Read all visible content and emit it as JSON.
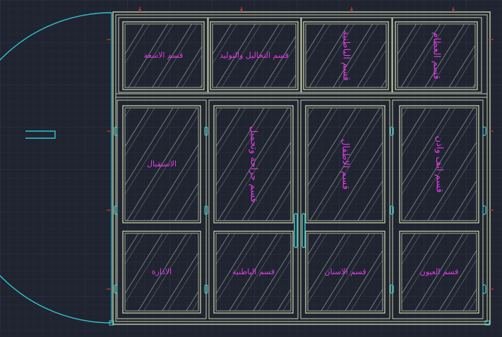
{
  "canvas": {
    "background": "#1f2430",
    "grid_minor": "#262c39",
    "grid_major": "#2e3544",
    "frame_color": "#c9cfa8",
    "glass_hatch_color": "#9aa39a",
    "label_color": "#e13ce6",
    "hinge_color": "#3fc6c6",
    "door_swing_color": "#33c4d4",
    "dimension_tick_color": "#c83a3a"
  },
  "top_row_labels": [
    "قسم الاشعة",
    "قسم التحاليل والتوليد",
    "قسم الباطنية",
    "قسم العظام"
  ],
  "middle_row_labels": [
    "الاستقبال",
    "قسم جراحة وتجميل",
    "قسم الاطفال",
    "قسم انف واذن"
  ],
  "bottom_row_labels": [
    "الادارة",
    "قسم الباطنية",
    "قسم الاسنان",
    "قسم العيون"
  ]
}
